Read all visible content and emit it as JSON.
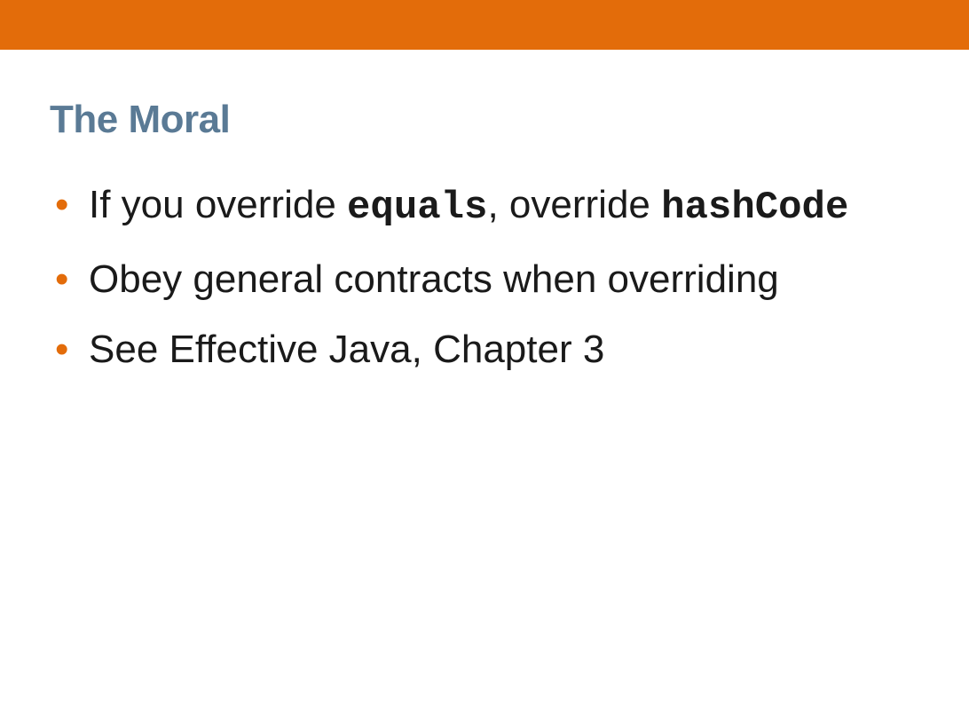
{
  "colors": {
    "accent": "#e36c0a",
    "title": "#5a7a95"
  },
  "title": "The Moral",
  "bullets": [
    {
      "segments": [
        {
          "text": "If you override ",
          "style": "plain"
        },
        {
          "text": "equals",
          "style": "code"
        },
        {
          "text": ", override ",
          "style": "plain"
        },
        {
          "text": "hashCode",
          "style": "code"
        }
      ]
    },
    {
      "segments": [
        {
          "text": "Obey general contracts when overriding",
          "style": "plain"
        }
      ]
    },
    {
      "segments": [
        {
          "text": "See Effective Java, Chapter 3",
          "style": "plain"
        }
      ]
    }
  ]
}
